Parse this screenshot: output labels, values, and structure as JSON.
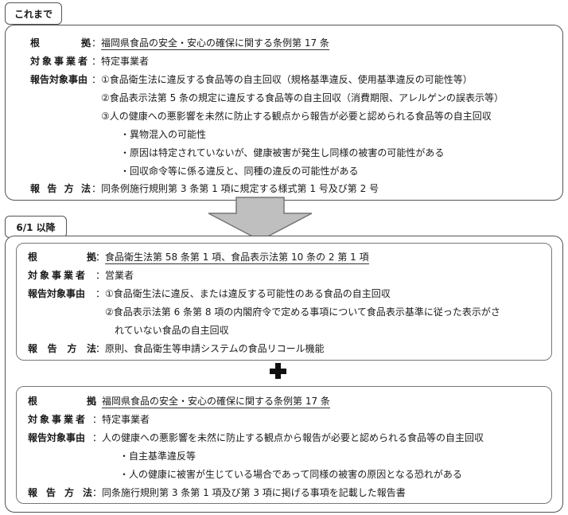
{
  "before": {
    "tab_label": "これまで",
    "labels": {
      "basis": [
        "根",
        "拠"
      ],
      "target": "対象事業者",
      "reason": "報告対象事由",
      "method": [
        "報",
        "告",
        "方",
        "法"
      ]
    },
    "basis_text": "福岡県食品の安全・安心の確保に関する条例第 17 条",
    "target_text": "特定事業者",
    "reasons": [
      "①食品衛生法に違反する食品等の自主回収（規格基準違反、使用基準違反の可能性等）",
      "②食品表示法第 5 条の規定に違反する食品等の自主回収（消費期限、アレルゲンの誤表示等）",
      "③人の健康への悪影響を未然に防止する観点から報告が必要と認められる食品等の自主回収",
      "・異物混入の可能性",
      "・原因は特定されていないが、健康被害が発生し同様の被害の可能性がある",
      "・回収命令等に係る違反と、同種の違反の可能性がある"
    ],
    "method_text": "同条例施行規則第 3 条第 1 項に規定する様式第 1 号及び第 2 号"
  },
  "after": {
    "tab_label": "6/1 以降",
    "national": {
      "basis_text": "食品衛生法第 58 条第 1 項、食品表示法第 10 条の 2 第 1 項",
      "target_text": "営業者",
      "reasons": [
        "①食品衛生法に違反、または違反する可能性のある食品の自主回収",
        "②食品表示法第 6 条第 8 項の内閣府令で定める事項について食品表示基準に従った表示がさ",
        "れていない食品の自主回収"
      ],
      "method_text": "原則、食品衛生等申請システムの食品リコール機能"
    },
    "prefecture": {
      "basis_text": "福岡県食品の安全・安心の確保に関する条例第 17 条",
      "target_text": "特定事業者",
      "reasons": [
        "人の健康への悪影響を未然に防止する観点から報告が必要と認められる食品等の自主回収",
        "・自主基準違反等",
        "・人の健康に被害が生じている場合であって同様の被害の原因となる恐れがある"
      ],
      "method_text": "同条施行規則第 3 条第 1 項及び第 3 項に掲げる事項を記載した報告書"
    }
  },
  "colors": {
    "arrow_fill": "#bfbfbf",
    "arrow_stroke": "#777777",
    "border": "#555555"
  }
}
